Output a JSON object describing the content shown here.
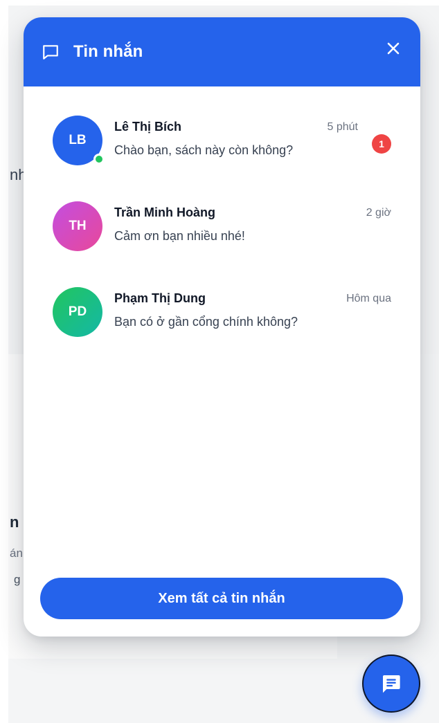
{
  "background": {
    "fragments": [
      "nh",
      "n h",
      "án",
      "g"
    ]
  },
  "panel": {
    "title": "Tin nhắn",
    "header_icon": "chat-bubble-icon",
    "close_icon": "close-icon",
    "conversations": [
      {
        "initials": "LB",
        "name": "Lê Thị Bích",
        "message": "Chào bạn, sách này còn không?",
        "time": "5 phút",
        "unread": "1",
        "online": true,
        "avatar_color": "#2563eb"
      },
      {
        "initials": "TH",
        "name": "Trần Minh Hoàng",
        "message": "Cảm ơn bạn nhiều nhé!",
        "time": "2 giờ",
        "online": false,
        "avatar_color": "#c94ed6"
      },
      {
        "initials": "PD",
        "name": "Phạm Thị Dung",
        "message": "Bạn có ở gần cổng chính không?",
        "time": "Hôm qua",
        "online": false,
        "avatar_color": "#1fbf8f"
      }
    ],
    "view_all_label": "Xem tất cả tin nhắn"
  },
  "fab": {
    "icon": "message-icon"
  },
  "colors": {
    "accent": "#2563eb",
    "badge": "#ef4444",
    "online": "#22c55e"
  }
}
